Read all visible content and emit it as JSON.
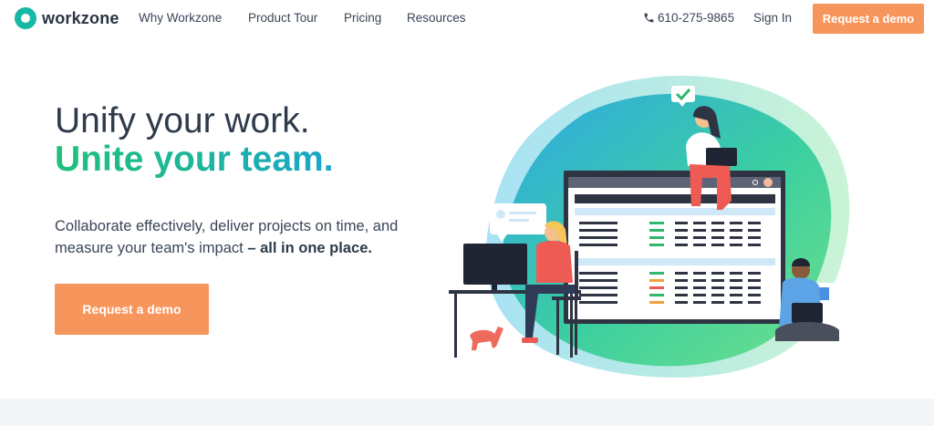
{
  "nav": {
    "logo_text": "workzone",
    "links": [
      "Why Workzone",
      "Product Tour",
      "Pricing",
      "Resources"
    ],
    "phone": "610-275-9865",
    "signin": "Sign In",
    "cta": "Request a demo"
  },
  "hero": {
    "headline_line1": "Unify your work.",
    "headline_line2": "Unite your team.",
    "sub_main": "Collaborate effectively, deliver projects on time, and measure your team's impact",
    "sub_bold": "– all in one place.",
    "cta": "Request a demo"
  },
  "colors": {
    "accent_orange": "#f7965c",
    "brand_teal": "#17b8a6",
    "headline_green": "#1fc17c",
    "text_dark": "#2f3b4c"
  },
  "icons": [
    "logo-icon",
    "phone-icon",
    "check-icon",
    "document-icon",
    "chat-bubble-icon",
    "search-icon"
  ]
}
